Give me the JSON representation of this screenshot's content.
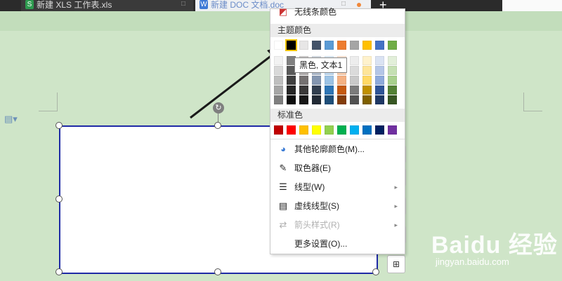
{
  "tabs": [
    {
      "label": "新建 XLS 工作表.xls",
      "icon": "spreadsheet-icon",
      "icon_glyph": "S"
    },
    {
      "label": "新建 DOC 文档.doc",
      "icon": "document-icon",
      "icon_glyph": "W"
    }
  ],
  "new_tab_glyph": "+",
  "menu": {
    "no_line_label": "无线条颜色",
    "theme_section": "主题颜色",
    "theme_top_row": [
      "#ffffff",
      "#000000",
      "#e7e6e6",
      "#44546a",
      "#5b9bd5",
      "#ed7d31",
      "#a5a5a5",
      "#ffc000",
      "#4472c4",
      "#70ad47"
    ],
    "theme_shades": [
      [
        "#f2f2f2",
        "#808080",
        "#d0cece",
        "#d6dce4",
        "#deebf6",
        "#fbe5d5",
        "#ededed",
        "#fff2cc",
        "#dae3f3",
        "#e2efd9"
      ],
      [
        "#d9d9d9",
        "#595959",
        "#aeaaaa",
        "#adb9ca",
        "#bdd7ee",
        "#f7cbac",
        "#dbdbdb",
        "#fee599",
        "#b4c6e7",
        "#c5e0b3"
      ],
      [
        "#bfbfbf",
        "#404040",
        "#757171",
        "#8496b0",
        "#9cc3e5",
        "#f4b183",
        "#c9c9c9",
        "#ffd965",
        "#8eaadb",
        "#a8d08d"
      ],
      [
        "#a6a6a6",
        "#262626",
        "#3a3838",
        "#323f4f",
        "#2e75b5",
        "#c55a11",
        "#7b7b7b",
        "#bf9000",
        "#2f5496",
        "#538135"
      ],
      [
        "#7f7f7f",
        "#0d0d0d",
        "#171616",
        "#222a35",
        "#1e4e79",
        "#833c0b",
        "#525252",
        "#7f6000",
        "#1f3864",
        "#375623"
      ]
    ],
    "selected_index": 1,
    "standard_section": "标准色",
    "standard_colors": [
      "#c00000",
      "#ff0000",
      "#ffc000",
      "#ffff00",
      "#92d050",
      "#00b050",
      "#00b0f0",
      "#0070c0",
      "#002060",
      "#7030a0"
    ],
    "items": [
      {
        "label": "其他轮廓颜色(M)...",
        "icon": "color-wheel-icon",
        "glyph": "◕",
        "submenu": false,
        "disabled": false
      },
      {
        "label": "取色器(E)",
        "icon": "eyedropper-icon",
        "glyph": "✎",
        "submenu": false,
        "disabled": false
      },
      {
        "label": "线型(W)",
        "icon": "line-weight-icon",
        "glyph": "☰",
        "submenu": true,
        "disabled": false
      },
      {
        "label": "虚线线型(S)",
        "icon": "dash-type-icon",
        "glyph": "▤",
        "submenu": true,
        "disabled": false
      },
      {
        "label": "箭头样式(R)",
        "icon": "arrow-style-icon",
        "glyph": "⇄",
        "submenu": true,
        "disabled": true
      },
      {
        "label": "更多设置(O)...",
        "icon": "",
        "glyph": "",
        "submenu": false,
        "disabled": false
      }
    ],
    "submenu_glyph": "▸"
  },
  "tooltip": "黑色, 文本1",
  "watermark": {
    "logo": "Baidu 经验",
    "url": "jingyan.baidu.com"
  },
  "colors": {
    "page_bg": "#cfe5c8",
    "shape_border": "#1f2aa6",
    "arrow": "#1a1a1a"
  }
}
